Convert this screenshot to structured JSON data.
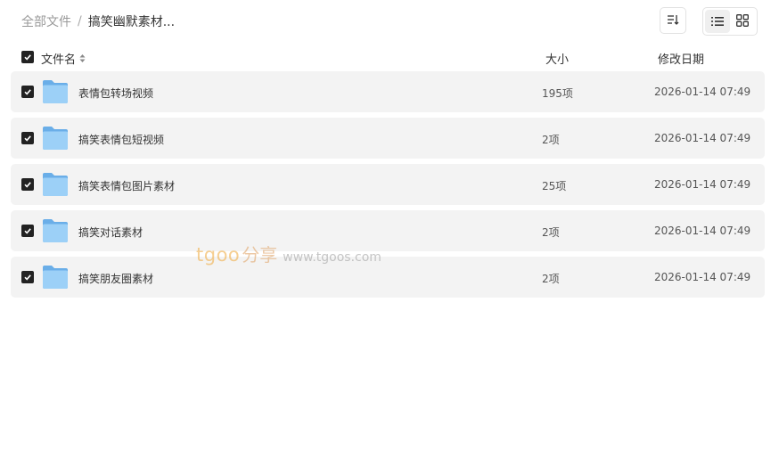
{
  "breadcrumb": {
    "root": "全部文件",
    "separator": "/",
    "current": "搞笑幽默素材..."
  },
  "toolbar": {
    "sort_icon": "sort-list-icon",
    "list_view_icon": "list-view-icon",
    "grid_view_icon": "grid-view-icon",
    "active_view": "list"
  },
  "table": {
    "headers": {
      "name": "文件名",
      "size": "大小",
      "date": "修改日期"
    },
    "rows": [
      {
        "name": "表情包转场视频",
        "size": "195项",
        "date": "2026-01-14 07:49",
        "checked": true
      },
      {
        "name": "搞笑表情包短视频",
        "size": "2项",
        "date": "2026-01-14 07:49",
        "checked": true
      },
      {
        "name": "搞笑表情包图片素材",
        "size": "25项",
        "date": "2026-01-14 07:49",
        "checked": true
      },
      {
        "name": "搞笑对话素材",
        "size": "2项",
        "date": "2026-01-14 07:49",
        "checked": true
      },
      {
        "name": "搞笑朋友圈素材",
        "size": "2项",
        "date": "2026-01-14 07:49",
        "checked": true
      }
    ]
  },
  "watermark": {
    "brand": "tgoo",
    "brand_cn": "分享",
    "url": "www.tgoos.com"
  },
  "colors": {
    "row_background": "#f3f3f3",
    "folder_blue": "#8cc4f2",
    "checkbox": "#222222"
  }
}
